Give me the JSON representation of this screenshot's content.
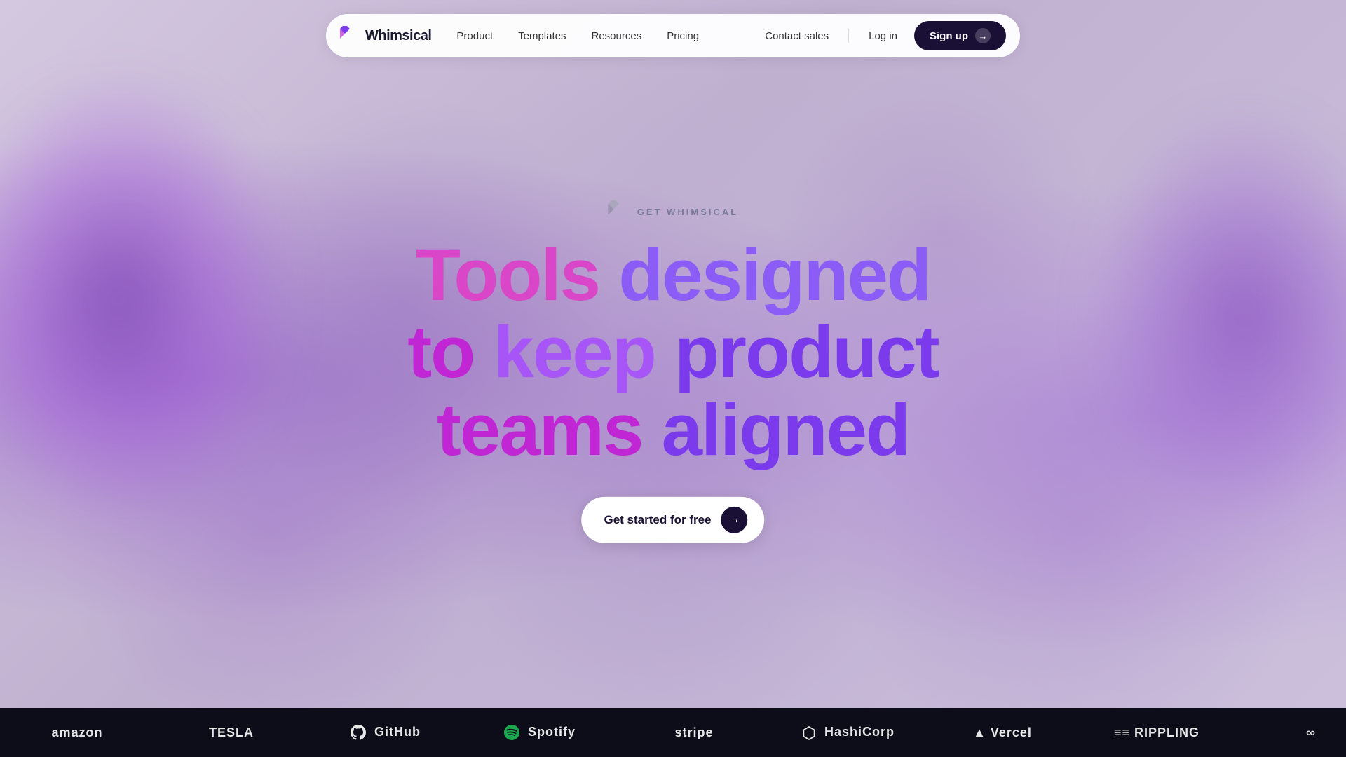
{
  "nav": {
    "logo_text": "Whimsical",
    "links": [
      {
        "id": "product",
        "label": "Product"
      },
      {
        "id": "templates",
        "label": "Templates"
      },
      {
        "id": "resources",
        "label": "Resources"
      },
      {
        "id": "pricing",
        "label": "Pricing"
      }
    ],
    "contact_sales": "Contact sales",
    "log_in": "Log in",
    "sign_up": "Sign up"
  },
  "hero": {
    "eyebrow": "GET WHIMSICAL",
    "headline_line1": "Tools designed",
    "headline_line2": "to keep product",
    "headline_line3": "teams aligned",
    "cta_label": "Get started for free"
  },
  "bottom_logos": [
    {
      "id": "amazon1",
      "label": "amazon"
    },
    {
      "id": "tesla",
      "label": "TESLA"
    },
    {
      "id": "github",
      "label": "GitHub"
    },
    {
      "id": "spotify",
      "label": "Spotify"
    },
    {
      "id": "stripe",
      "label": "stripe"
    },
    {
      "id": "hashicorp",
      "label": "HashiCorp"
    },
    {
      "id": "vercel",
      "label": "▲ Vercel"
    },
    {
      "id": "rippling",
      "label": "RIPPLING"
    },
    {
      "id": "meta",
      "label": "Meta"
    },
    {
      "id": "amazon2",
      "label": "amazon"
    }
  ]
}
